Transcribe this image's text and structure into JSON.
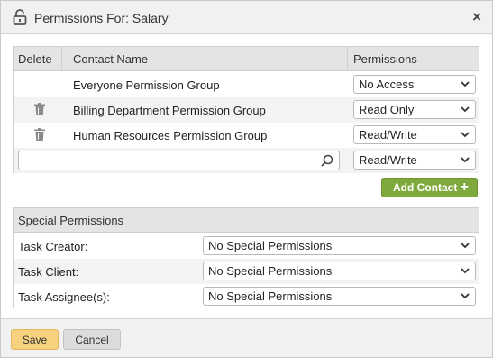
{
  "dialog": {
    "title": "Permissions For: Salary",
    "lock_icon": "unlock-icon",
    "close_label": "×"
  },
  "table": {
    "headers": {
      "delete": "Delete",
      "contact": "Contact Name",
      "permissions": "Permissions"
    },
    "rows": [
      {
        "name": "Everyone Permission Group",
        "permission": "No Access",
        "deletable": false
      },
      {
        "name": "Billing Department Permission Group",
        "permission": "Read Only",
        "deletable": true
      },
      {
        "name": "Human Resources Permission Group",
        "permission": "Read/Write",
        "deletable": true
      }
    ],
    "new_row": {
      "search_value": "",
      "permission": "Read/Write"
    }
  },
  "add_contact": {
    "label": "Add Contact",
    "icon": "plus-icon"
  },
  "special": {
    "title": "Special Permissions",
    "rows": [
      {
        "label": "Task Creator:",
        "value": "No Special Permissions"
      },
      {
        "label": "Task Client:",
        "value": "No Special Permissions"
      },
      {
        "label": "Task Assignee(s):",
        "value": "No Special Permissions"
      }
    ]
  },
  "footer": {
    "save_label": "Save",
    "cancel_label": "Cancel"
  },
  "colors": {
    "accent_green": "#7fa93c",
    "save_yellow": "#f7d27e",
    "header_gray": "#e4e4e4"
  }
}
